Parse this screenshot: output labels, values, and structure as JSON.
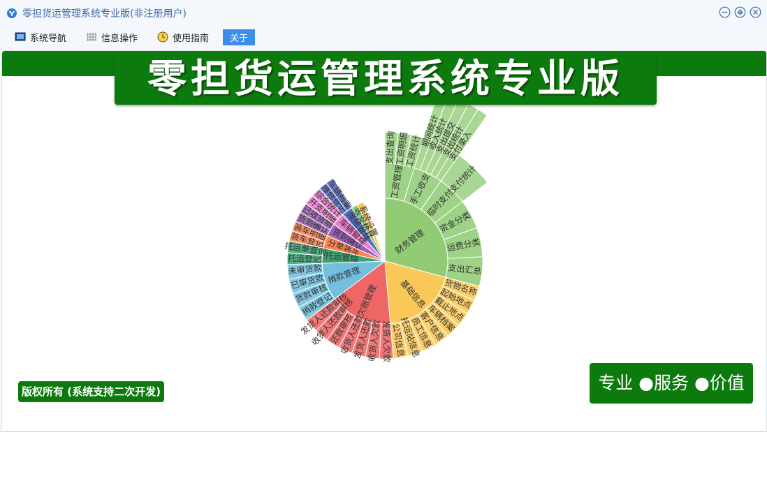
{
  "window": {
    "title": "零担货运管理系统专业版(非注册用户)",
    "controls": [
      "minimize-icon",
      "restore-icon",
      "close-icon"
    ]
  },
  "menu": [
    {
      "label": "系统导航",
      "icon": "monitor-icon"
    },
    {
      "label": "信息操作",
      "icon": "grid-icon"
    },
    {
      "label": "使用指南",
      "icon": "clock-icon"
    },
    {
      "label": "关于",
      "icon": "",
      "active": true
    }
  ],
  "banner": {
    "title": "零担货运管理系统专业版"
  },
  "footer": {
    "copyright": "版权所有 (系统支持二次开发)",
    "slogan": "专业 ●服务 ●价值"
  },
  "colors": {
    "brand_green": "#0c7a0c",
    "title_blue": "#3a6aa5",
    "active_menu": "#3c8ee8"
  },
  "chart_data": {
    "type": "sunburst",
    "groups": [
      {
        "name": "财务管理",
        "color": "#91cc75",
        "children": [
          {
            "name": "工资管理",
            "children": [
              "支出查询",
              "工资明细",
              "工资统计"
            ]
          },
          {
            "name": "手工收支",
            "children": [
              "期间统计",
              "收入统计",
              "支出提交",
              "支出统计",
              "支付录入"
            ]
          },
          {
            "name": "临时支付",
            "children": [
              "支付统计"
            ]
          },
          {
            "name": "资金分类",
            "children": []
          },
          {
            "name": "运费分类",
            "children": []
          },
          {
            "name": "支出汇总",
            "children": []
          }
        ]
      },
      {
        "name": "基础信息",
        "color": "#fac858",
        "children": [
          {
            "name": "货物名称",
            "children": []
          },
          {
            "name": "起始地点",
            "children": []
          },
          {
            "name": "截止地点",
            "children": []
          },
          {
            "name": "车辆档案",
            "children": []
          },
          {
            "name": "客户信息",
            "children": []
          },
          {
            "name": "员工信息",
            "children": []
          },
          {
            "name": "托运站信息",
            "children": []
          },
          {
            "name": "公司信息",
            "children": []
          }
        ]
      },
      {
        "name": "欠账管理",
        "color": "#ee6666",
        "children": [
          {
            "name": "发货人欠款",
            "children": []
          },
          {
            "name": "收货人欠款",
            "children": []
          },
          {
            "name": "发货人还款",
            "children": []
          },
          {
            "name": "收货人还款",
            "children": []
          },
          {
            "name": "还款审核",
            "children": []
          },
          {
            "name": "收货人还款审核",
            "children": []
          },
          {
            "name": "发货人还款审核",
            "children": []
          }
        ]
      },
      {
        "name": "捎款管理",
        "color": "#73c0de",
        "children": [
          {
            "name": "捎款登记",
            "children": []
          },
          {
            "name": "货款审核",
            "children": []
          },
          {
            "name": "已审货款",
            "children": []
          },
          {
            "name": "未审货款",
            "children": []
          }
        ]
      },
      {
        "name": "托运管理",
        "color": "#3ba272",
        "children": [
          {
            "name": "托运登记",
            "children": []
          },
          {
            "name": "托运单查询",
            "children": []
          }
        ]
      },
      {
        "name": "分单装车",
        "color": "#fc8452",
        "children": [
          {
            "name": "装车登记",
            "children": []
          },
          {
            "name": "装车明细",
            "children": []
          }
        ]
      },
      {
        "name": "货到确认",
        "color": "#9a60b4",
        "children": [
          {
            "name": "货到确认",
            "children": []
          },
          {
            "name": "已收货物",
            "children": []
          }
        ]
      },
      {
        "name": "车辆管理",
        "color": "#ea7ccc",
        "children": [
          {
            "name": "开支明细",
            "children": []
          },
          {
            "name": "综合统计",
            "children": []
          }
        ]
      },
      {
        "name": "维修管理",
        "color": "#5470c6",
        "children": [
          {
            "name": "维修登记",
            "children": []
          },
          {
            "name": "车辆档案",
            "children": []
          }
        ]
      },
      {
        "name": "收支统计",
        "color": "#91cc75",
        "children": []
      },
      {
        "name": "系统设置",
        "color": "#fac858",
        "children": []
      }
    ]
  }
}
